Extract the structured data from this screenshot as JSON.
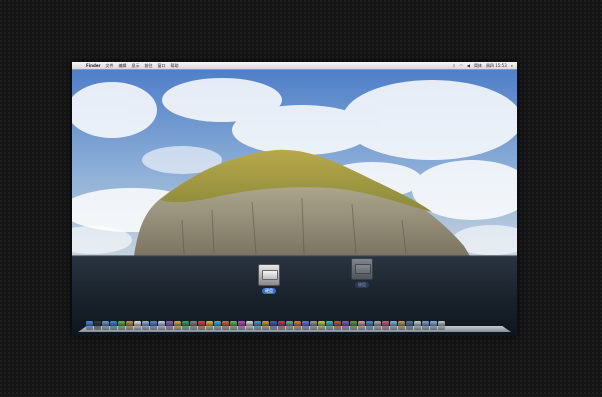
{
  "menubar": {
    "app_name": "Finder",
    "menus": [
      "文件",
      "编辑",
      "显示",
      "前往",
      "窗口",
      "帮助"
    ],
    "status": {
      "input": "简体",
      "clock": "周四 15:53"
    }
  },
  "desktop": {
    "icons": [
      {
        "name": "hard-disk",
        "label": "硬盘"
      },
      {
        "name": "dragging-disk",
        "label": "硬盘"
      }
    ]
  },
  "dock": {
    "items": [
      {
        "name": "finder",
        "color": "#4a8fe0"
      },
      {
        "name": "dashboard",
        "color": "#3b3b3b"
      },
      {
        "name": "mail",
        "color": "#6ea0d8"
      },
      {
        "name": "safari",
        "color": "#3a8ed8"
      },
      {
        "name": "ichat",
        "color": "#65b84a"
      },
      {
        "name": "address-book",
        "color": "#c79a52"
      },
      {
        "name": "ical",
        "color": "#e6e6e6"
      },
      {
        "name": "preview",
        "color": "#9fb8d8"
      },
      {
        "name": "itunes",
        "color": "#5c8ad8"
      },
      {
        "name": "iphoto",
        "color": "#c7d6e6"
      },
      {
        "name": "imovie",
        "color": "#8a6ac8"
      },
      {
        "name": "garageband",
        "color": "#d8b04a"
      },
      {
        "name": "time-machine",
        "color": "#3aa86a"
      },
      {
        "name": "system-preferences",
        "color": "#8a8a8a"
      },
      {
        "name": "app-15",
        "color": "#d84a4a"
      },
      {
        "name": "app-16",
        "color": "#e0c040"
      },
      {
        "name": "app-17",
        "color": "#4ab0e0"
      },
      {
        "name": "app-18",
        "color": "#e06a3a"
      },
      {
        "name": "app-19",
        "color": "#60c060"
      },
      {
        "name": "app-20",
        "color": "#c050c0"
      },
      {
        "name": "app-21",
        "color": "#e0e0e0"
      },
      {
        "name": "app-22",
        "color": "#50a0d0"
      },
      {
        "name": "app-23",
        "color": "#d0a040"
      },
      {
        "name": "app-24",
        "color": "#4060c0"
      },
      {
        "name": "app-25",
        "color": "#c04060"
      },
      {
        "name": "app-26",
        "color": "#70b0a0"
      },
      {
        "name": "app-27",
        "color": "#e08040"
      },
      {
        "name": "app-28",
        "color": "#6080e0"
      },
      {
        "name": "app-29",
        "color": "#a0a0a0"
      },
      {
        "name": "app-30",
        "color": "#d0d040"
      },
      {
        "name": "app-31",
        "color": "#40c0c0"
      },
      {
        "name": "app-32",
        "color": "#c06040"
      },
      {
        "name": "app-33",
        "color": "#8060c0"
      },
      {
        "name": "app-34",
        "color": "#60a040"
      },
      {
        "name": "app-35",
        "color": "#e0a0a0"
      },
      {
        "name": "app-36",
        "color": "#5090d0"
      },
      {
        "name": "app-37",
        "color": "#b0b0b0"
      },
      {
        "name": "app-38",
        "color": "#d06080"
      },
      {
        "name": "app-39",
        "color": "#80c0e0"
      },
      {
        "name": "app-40",
        "color": "#c0a060"
      },
      {
        "name": "app-41",
        "color": "#5080a0"
      },
      {
        "name": "app-42",
        "color": "#d0d0d0"
      },
      {
        "name": "downloads-stack",
        "color": "#7aa8d8"
      },
      {
        "name": "documents-stack",
        "color": "#8ab4e0"
      },
      {
        "name": "trash",
        "color": "#c8c8c8"
      }
    ]
  }
}
